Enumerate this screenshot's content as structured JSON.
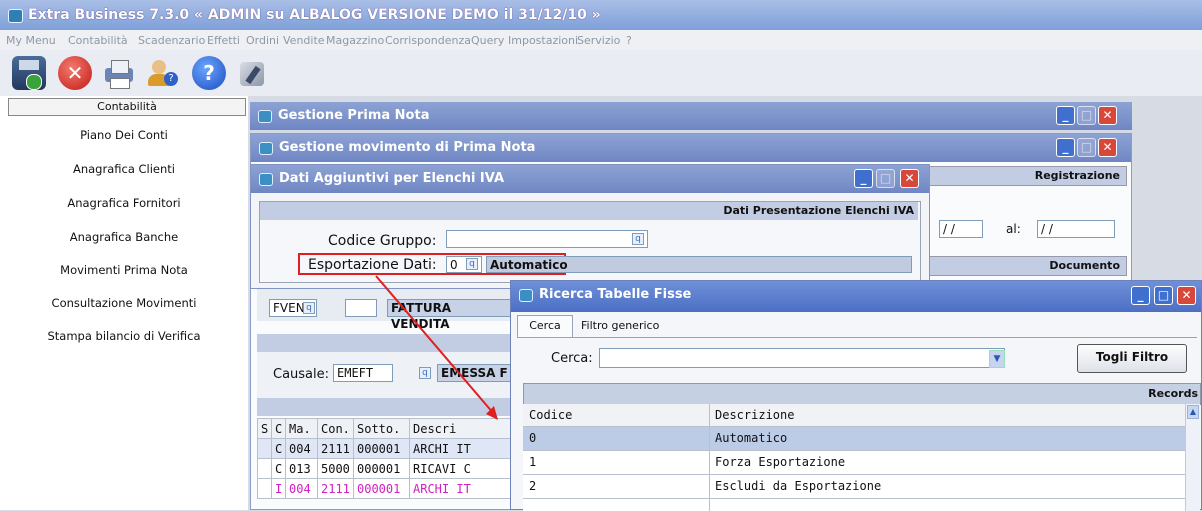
{
  "app": {
    "title": "Extra Business 7.3.0  « ADMIN su ALBALOG VERSIONE DEMO il 31/12/10 »"
  },
  "menu": [
    "My Menu",
    "Contabilità",
    "Scadenzario",
    "Effetti",
    "Ordini",
    "Vendite",
    "Magazzino",
    "Corrispondenza",
    "Query",
    "Impostazioni",
    "Servizio",
    "?"
  ],
  "toolbar": {
    "icons": [
      "save-icon",
      "close-icon",
      "print-icon",
      "users-help-icon",
      "help-icon",
      "tools-icon"
    ]
  },
  "sidebar": {
    "header": "Contabilità",
    "items": [
      "Piano Dei Conti",
      "Anagrafica Clienti",
      "Anagrafica Fornitori",
      "Anagrafica Banche",
      "Movimenti Prima Nota",
      "Consultazione Movimenti",
      "Stampa bilancio di Verifica"
    ]
  },
  "win_prima_nota": {
    "title": "Gestione Prima Nota"
  },
  "win_movimento": {
    "title": "Gestione movimento di Prima Nota",
    "registrazione": "Registrazione",
    "date_sep": "/  /",
    "al_label": "al:",
    "date2": "/  /",
    "documento": "Documento",
    "doc_code": "FVEN",
    "doc_desc": "FATTURA VENDITA",
    "causale_label": "Causale:",
    "causale_value": "EMEFT",
    "causale_desc": "EMESSA F",
    "grid_headers": [
      "S",
      "C",
      "Ma.",
      "Con.",
      "Sotto.",
      "Descri"
    ],
    "grid_rows": [
      [
        "",
        "C",
        "004",
        "2111",
        "000001",
        "ARCHI IT"
      ],
      [
        "",
        "C",
        "013",
        "5000",
        "000001",
        "RICAVI C"
      ],
      [
        "",
        "I",
        "004",
        "2111",
        "000001",
        "ARCHI IT"
      ]
    ]
  },
  "win_dati": {
    "title": "Dati Aggiuntivi per Elenchi IVA",
    "section": "Dati Presentazione Elenchi IVA",
    "codice_label": "Codice Gruppo:",
    "codice_value": "",
    "esport_label": "Esportazione Dati:",
    "esport_value": "0",
    "esport_desc": "Automatico"
  },
  "win_ricerca": {
    "title": "Ricerca Tabelle Fisse",
    "tabs": [
      "Cerca",
      "Filtro generico"
    ],
    "cerca_label": "Cerca:",
    "cerca_value": "",
    "togli_filtro": "Togli Filtro",
    "records": "Records",
    "headers": [
      "Codice",
      "Descrizione"
    ],
    "rows": [
      [
        "0",
        "Automatico"
      ],
      [
        "1",
        "Forza Esportazione"
      ],
      [
        "2",
        "Escludi da Esportazione"
      ]
    ]
  }
}
